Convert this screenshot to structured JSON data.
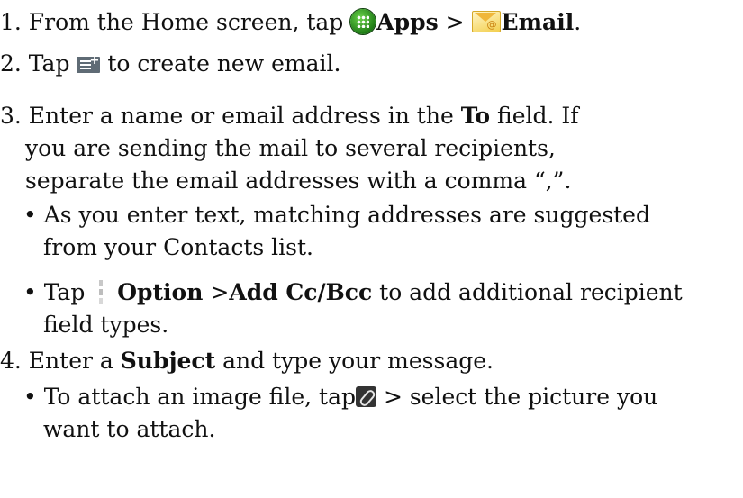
{
  "step1": {
    "prefix": "1. From the Home screen, tap ",
    "apps": "Apps",
    "sep": " > ",
    "email": "Email",
    "end": "."
  },
  "step2": {
    "prefix": "2. Tap ",
    "suffix": " to create new email."
  },
  "step3": {
    "l1a": "3. Enter a name or email address in the ",
    "to": "To",
    "l1b": " field. If",
    "l2": "you are sending the mail to several recipients,",
    "l3": "separate the email addresses with a comma “,”."
  },
  "bullet1": {
    "l1": "• As you enter text, matching addresses are suggested",
    "l2": "from your Contacts list."
  },
  "bullet2": {
    "prefix": "• Tap ",
    "option": "Option",
    "sep": " >",
    "addccbcc": "Add Cc/Bcc",
    "suffix": " to add additional recipient",
    "l2": "field types."
  },
  "step4": {
    "prefix": "4. Enter a ",
    "subject": "Subject",
    "suffix": " and type your message."
  },
  "bullet3": {
    "prefix": "• To attach an image file, tap",
    "suffix": " > select the picture you",
    "l2": "want to attach."
  },
  "icons": {
    "apps": "apps-grid-icon",
    "email": "email-envelope-icon",
    "compose": "compose-icon",
    "option": "overflow-menu-icon",
    "attach": "paperclip-icon"
  }
}
